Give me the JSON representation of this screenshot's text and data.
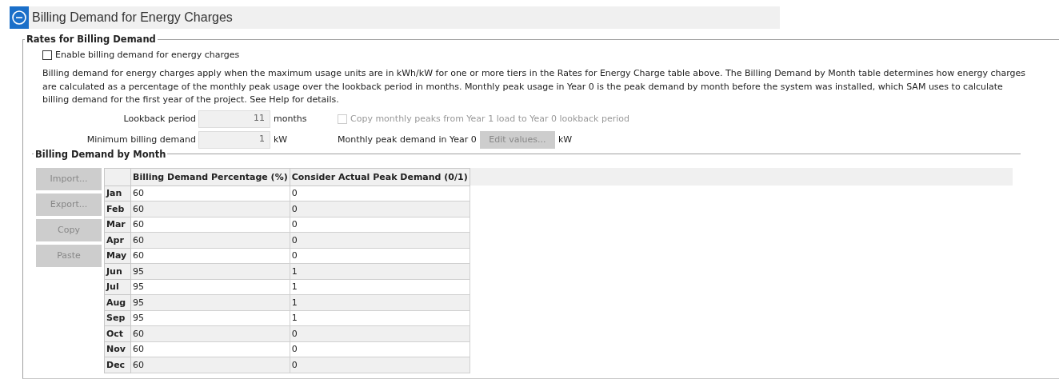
{
  "header": {
    "title": "Billing Demand for Energy Charges",
    "expanded": true
  },
  "rates_group": {
    "title": "Rates for Billing Demand",
    "enable_checkbox": {
      "label": "Enable billing demand for energy charges",
      "checked": false
    },
    "description": "Billing demand for energy charges apply when the maximum usage units are in kWh/kW for one or more tiers in the Rates for Energy Charge table above. The Billing Demand by Month table determines how energy charges are calculated as a percentage of the monthly peak usage over the lookback period in months. Monthly peak usage in Year 0 is the peak demand by month before the system was installed, which SAM uses to calculate billing demand for the first year of the project. See Help for details.",
    "lookback": {
      "label": "Lookback period",
      "value": "11",
      "unit": "months"
    },
    "copy_checkbox": {
      "label": "Copy monthly peaks from Year 1 load to Year 0 lookback period",
      "checked": false,
      "disabled": true
    },
    "min_demand": {
      "label": "Minimum billing demand",
      "value": "1",
      "unit": "kW"
    },
    "peak_demand": {
      "label": "Monthly peak demand in Year 0",
      "button": "Edit values...",
      "unit": "kW"
    }
  },
  "month_group": {
    "title": "Billing Demand by Month",
    "buttons": [
      {
        "label": "Import...",
        "disabled": true
      },
      {
        "label": "Export...",
        "disabled": true
      },
      {
        "label": "Copy",
        "disabled": true
      },
      {
        "label": "Paste",
        "disabled": true
      }
    ],
    "table": {
      "columns": [
        "Billing Demand Percentage (%)",
        "Consider Actual Peak Demand (0/1)"
      ],
      "rows": [
        {
          "month": "Jan",
          "cells": [
            "60",
            "0"
          ]
        },
        {
          "month": "Feb",
          "cells": [
            "60",
            "0"
          ]
        },
        {
          "month": "Mar",
          "cells": [
            "60",
            "0"
          ]
        },
        {
          "month": "Apr",
          "cells": [
            "60",
            "0"
          ]
        },
        {
          "month": "May",
          "cells": [
            "60",
            "0"
          ]
        },
        {
          "month": "Jun",
          "cells": [
            "95",
            "1"
          ]
        },
        {
          "month": "Jul",
          "cells": [
            "95",
            "1"
          ]
        },
        {
          "month": "Aug",
          "cells": [
            "95",
            "1"
          ]
        },
        {
          "month": "Sep",
          "cells": [
            "95",
            "1"
          ]
        },
        {
          "month": "Oct",
          "cells": [
            "60",
            "0"
          ]
        },
        {
          "month": "Nov",
          "cells": [
            "60",
            "0"
          ]
        },
        {
          "month": "Dec",
          "cells": [
            "60",
            "0"
          ]
        }
      ]
    }
  }
}
